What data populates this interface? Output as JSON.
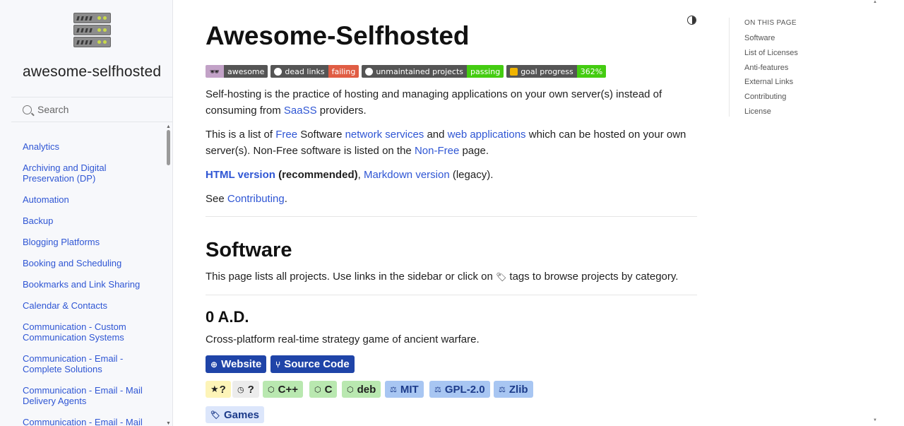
{
  "sidebar": {
    "site_title": "awesome-selfhosted",
    "search_placeholder": "Search",
    "items": [
      {
        "label": "Analytics"
      },
      {
        "label": "Archiving and Digital Preservation (DP)"
      },
      {
        "label": "Automation"
      },
      {
        "label": "Backup"
      },
      {
        "label": "Blogging Platforms"
      },
      {
        "label": "Booking and Scheduling"
      },
      {
        "label": "Bookmarks and Link Sharing"
      },
      {
        "label": "Calendar & Contacts"
      },
      {
        "label": "Communication - Custom Communication Systems"
      },
      {
        "label": "Communication - Email - Complete Solutions"
      },
      {
        "label": "Communication - Email - Mail Delivery Agents"
      },
      {
        "label": "Communication - Email - Mail"
      }
    ]
  },
  "main": {
    "title": "Awesome-Selfhosted",
    "badges": [
      {
        "left": "awesome",
        "right": "",
        "left_color": "#555555",
        "right_color": ""
      },
      {
        "left": "dead links",
        "right": "failing",
        "left_color": "#555555",
        "right_color": "#e05d44"
      },
      {
        "left": "unmaintained projects",
        "right": "passing",
        "left_color": "#555555",
        "right_color": "#4c1"
      },
      {
        "left": "goal progress",
        "right": "362%",
        "left_color": "#555555",
        "right_color": "#4c1"
      }
    ],
    "intro": {
      "p1_a": "Self-hosting is the practice of hosting and managing applications on your own server(s) instead of consuming from ",
      "p1_link": "SaaSS",
      "p1_b": " providers.",
      "p2_a": "This is a list of ",
      "p2_link1": "Free",
      "p2_b": " Software ",
      "p2_link2": "network services",
      "p2_c": " and ",
      "p2_link3": "web applications",
      "p2_d": " which can be hosted on your own server(s). Non-Free software is listed on the ",
      "p2_link4": "Non-Free",
      "p2_e": " page.",
      "p3_link1": "HTML version",
      "p3_bold": " (recommended)",
      "p3_a": ", ",
      "p3_link2": "Markdown version",
      "p3_b": " (legacy).",
      "p4_a": "See ",
      "p4_link": "Contributing",
      "p4_b": "."
    },
    "software_heading": "Software",
    "software_desc_a": "This page lists all projects. Use links in the sidebar or click on ",
    "software_desc_b": " tags to browse projects by category.",
    "project": {
      "name": "0 A.D.",
      "description": "Cross-platform real-time strategy game of ancient warfare.",
      "buttons": {
        "website": "Website",
        "source": "Source Code"
      },
      "tags": [
        {
          "label": "?",
          "icon": "star-icon",
          "bg": "#fdf4b8"
        },
        {
          "label": "?",
          "icon": "clock-icon",
          "bg": "#ececec"
        },
        {
          "label": "C++",
          "icon": "cube-icon",
          "bg": "#b9e8b0"
        },
        {
          "label": "C",
          "icon": "cube-icon",
          "bg": "#b9e8b0"
        },
        {
          "label": "deb",
          "icon": "cube-icon",
          "bg": "#b9e8b0"
        },
        {
          "label": "MIT",
          "icon": "scale-icon",
          "bg": "#a8c6f2"
        },
        {
          "label": "GPL-2.0",
          "icon": "scale-icon",
          "bg": "#a8c6f2"
        },
        {
          "label": "Zlib",
          "icon": "scale-icon",
          "bg": "#a8c6f2"
        },
        {
          "label": "Games",
          "icon": "tag-icon",
          "bg": "#dce6fb"
        }
      ]
    }
  },
  "toc": {
    "heading": "ON THIS PAGE",
    "items": [
      "Software",
      "List of Licenses",
      "Anti-features",
      "External Links",
      "Contributing",
      "License"
    ]
  }
}
